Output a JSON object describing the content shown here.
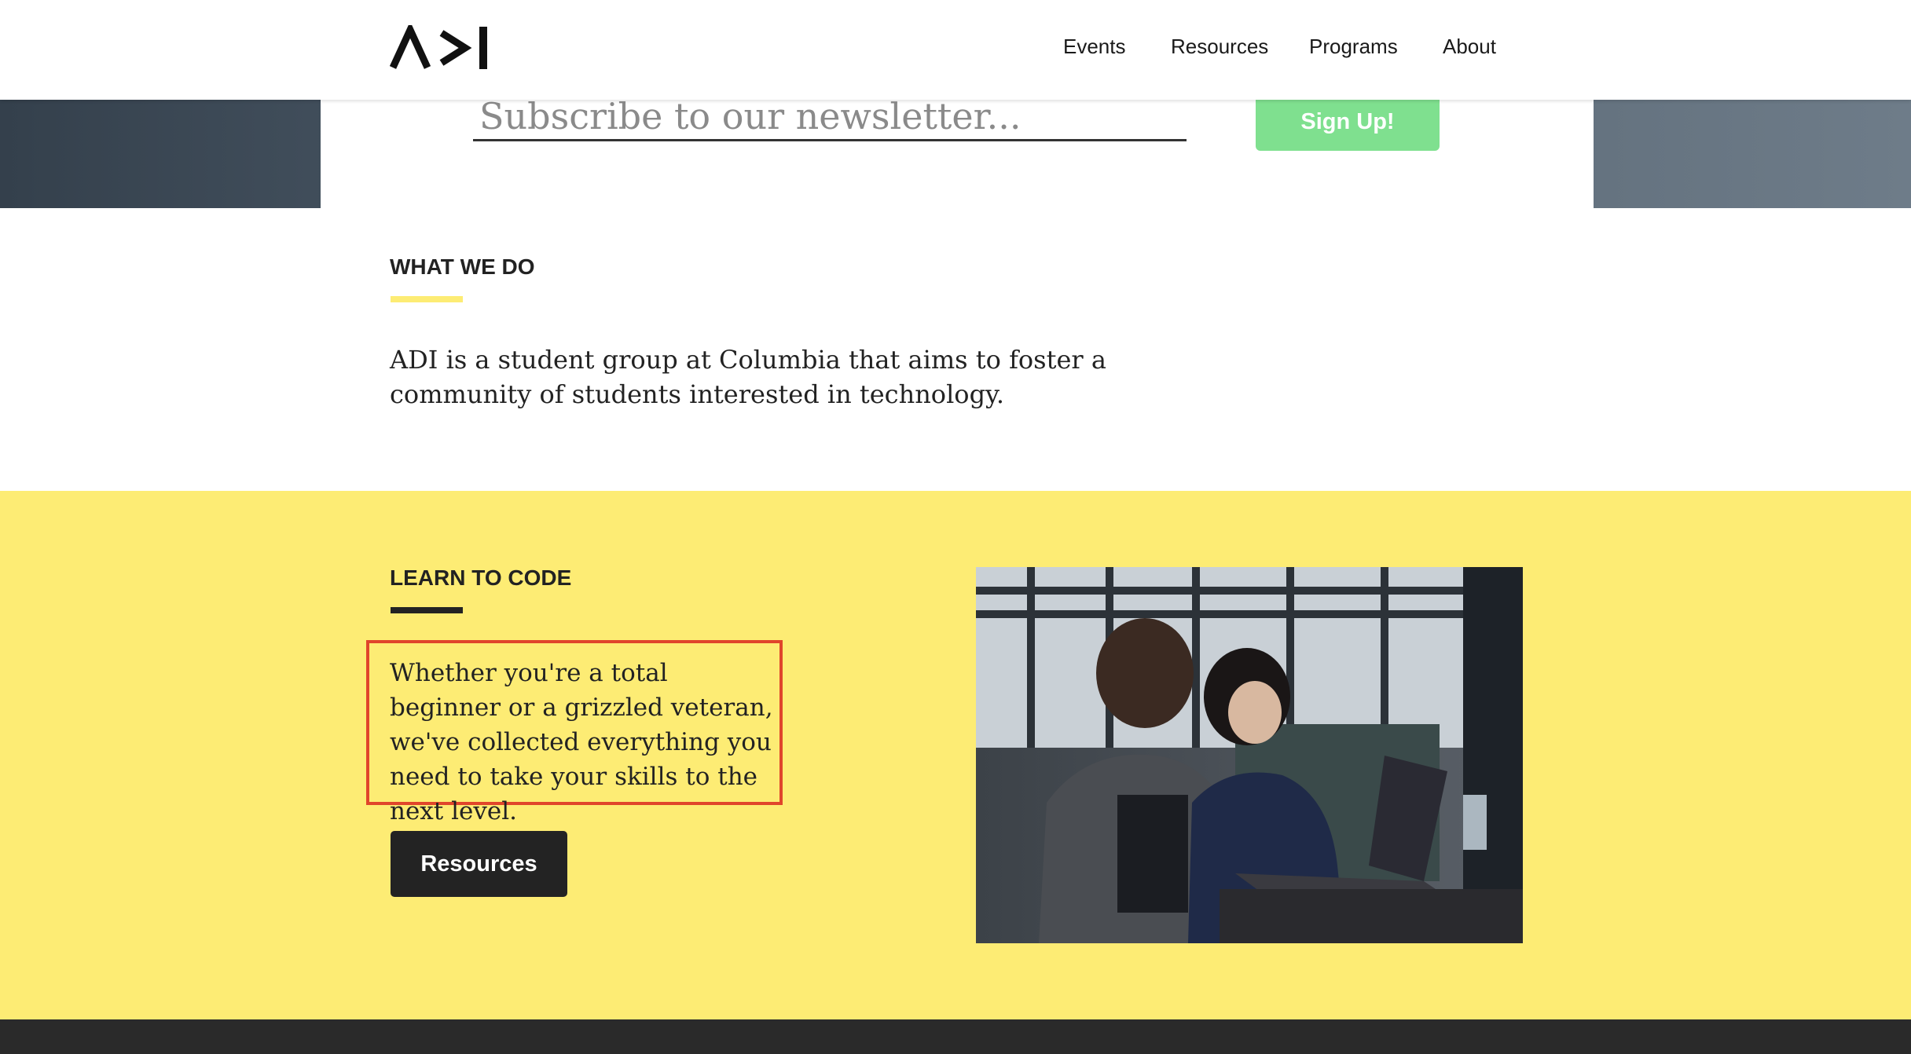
{
  "header": {
    "logo_alt": "ADI",
    "nav": [
      {
        "label": "Events"
      },
      {
        "label": "Resources"
      },
      {
        "label": "Programs"
      },
      {
        "label": "About"
      }
    ]
  },
  "newsletter": {
    "placeholder": "Subscribe to our newsletter...",
    "button_label": "Sign Up!"
  },
  "what_we_do": {
    "heading": "WHAT WE DO",
    "text": "ADI is a student group at Columbia that aims to foster a community of students interested in technology."
  },
  "learn_to_code": {
    "heading": "LEARN TO CODE",
    "text": "Whether you're a total beginner or a grizzled veteran, we've collected everything you need to take your skills to the next level.",
    "button_label": "Resources"
  },
  "colors": {
    "accent_yellow": "#fdec74",
    "signup_green": "#7fe08f",
    "highlight_red": "#e0452b",
    "dark": "#232323"
  }
}
